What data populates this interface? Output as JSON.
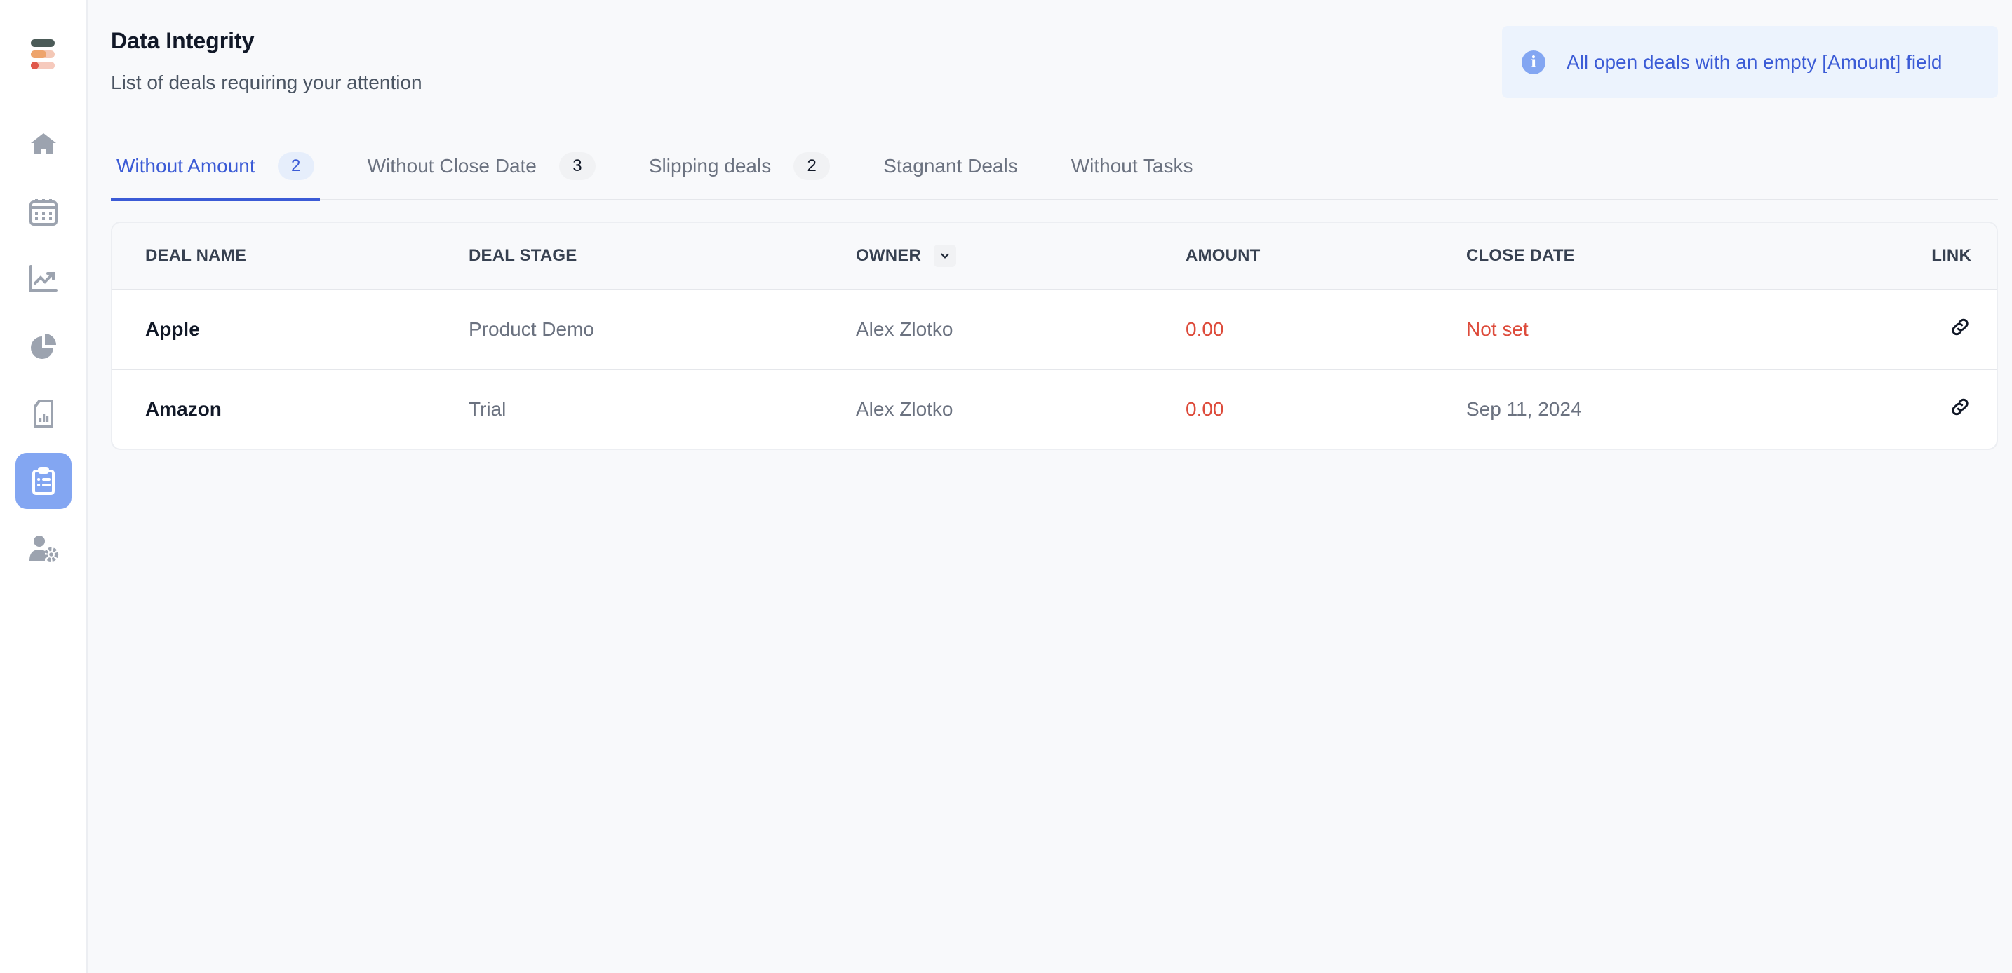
{
  "sidebar": {
    "items": [
      {
        "name": "home",
        "icon": "home-icon",
        "active": false
      },
      {
        "name": "calendar",
        "icon": "calendar-icon",
        "active": false
      },
      {
        "name": "trends",
        "icon": "line-chart-icon",
        "active": false
      },
      {
        "name": "pie",
        "icon": "pie-chart-icon",
        "active": false
      },
      {
        "name": "reports",
        "icon": "report-icon",
        "active": false
      },
      {
        "name": "data-integrity",
        "icon": "clipboard-list-icon",
        "active": true
      },
      {
        "name": "user-settings",
        "icon": "user-gear-icon",
        "active": false
      }
    ],
    "colors": {
      "icon": "#9ca3af",
      "active_bg": "#83a6f2"
    }
  },
  "header": {
    "title": "Data Integrity",
    "subtitle": "List of deals requiring your attention"
  },
  "info": {
    "icon": "info-icon",
    "text": "All open deals with an empty [Amount] field"
  },
  "tabs": [
    {
      "label": "Without Amount",
      "count": "2",
      "active": true
    },
    {
      "label": "Without Close Date",
      "count": "3",
      "active": false
    },
    {
      "label": "Slipping deals",
      "count": "2",
      "active": false
    },
    {
      "label": "Stagnant Deals",
      "count": null,
      "active": false
    },
    {
      "label": "Without Tasks",
      "count": null,
      "active": false
    }
  ],
  "table": {
    "columns": [
      "DEAL NAME",
      "DEAL STAGE",
      "OWNER",
      "AMOUNT",
      "CLOSE DATE",
      "LINK"
    ],
    "rows": [
      {
        "deal_name": "Apple",
        "deal_stage": "Product Demo",
        "owner": "Alex Zlotko",
        "amount": "0.00",
        "close_date": "Not set",
        "close_date_missing": true
      },
      {
        "deal_name": "Amazon",
        "deal_stage": "Trial",
        "owner": "Alex Zlotko",
        "amount": "0.00",
        "close_date": "Sep 11, 2024",
        "close_date_missing": false
      }
    ]
  },
  "colors": {
    "accent": "#3b5bd6",
    "warning": "#dd4b3b",
    "info_bg": "#ecf3fd"
  }
}
